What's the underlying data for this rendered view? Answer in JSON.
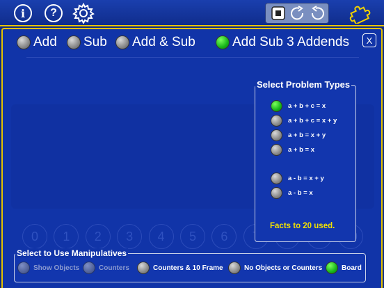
{
  "toolbar": {
    "info_glyph": "i",
    "help_glyph": "?",
    "icons": [
      "info-icon",
      "help-icon",
      "gear-icon",
      "stop-icon",
      "redo-icon",
      "undo-icon",
      "puzzle-icon"
    ],
    "accent_color": "#e6c200"
  },
  "modes": [
    {
      "label": "Add",
      "selected": false
    },
    {
      "label": "Sub",
      "selected": false
    },
    {
      "label": "Add & Sub",
      "selected": false
    },
    {
      "label": "Add Sub 3 Addends",
      "selected": true
    }
  ],
  "close_label": "X",
  "problem_types": {
    "title": "Select Problem Types",
    "items": [
      {
        "label": "a + b + c = x",
        "selected": true
      },
      {
        "label": "a + b + c = x + y",
        "selected": false
      },
      {
        "label": "a + b = x + y",
        "selected": false
      },
      {
        "label": "a + b = x",
        "selected": false
      },
      {
        "label": "a - b = x + y",
        "selected": false
      },
      {
        "label": "a - b = x",
        "selected": false
      }
    ],
    "footer": "Facts to 20 used."
  },
  "number_line": [
    "0",
    "1",
    "2",
    "3",
    "4",
    "5",
    "6",
    "7",
    "8",
    "9",
    "10"
  ],
  "manipulatives": {
    "title": "Select to Use Manipulatives",
    "items": [
      {
        "label": "Show Objects",
        "selected": false,
        "enabled": false
      },
      {
        "label": "Counters",
        "selected": false,
        "enabled": false
      },
      {
        "label": "Counters & 10 Frame",
        "selected": false,
        "enabled": true
      },
      {
        "label": "No Objects or Counters",
        "selected": false,
        "enabled": true
      },
      {
        "label": "Board",
        "selected": true,
        "enabled": true
      }
    ]
  }
}
